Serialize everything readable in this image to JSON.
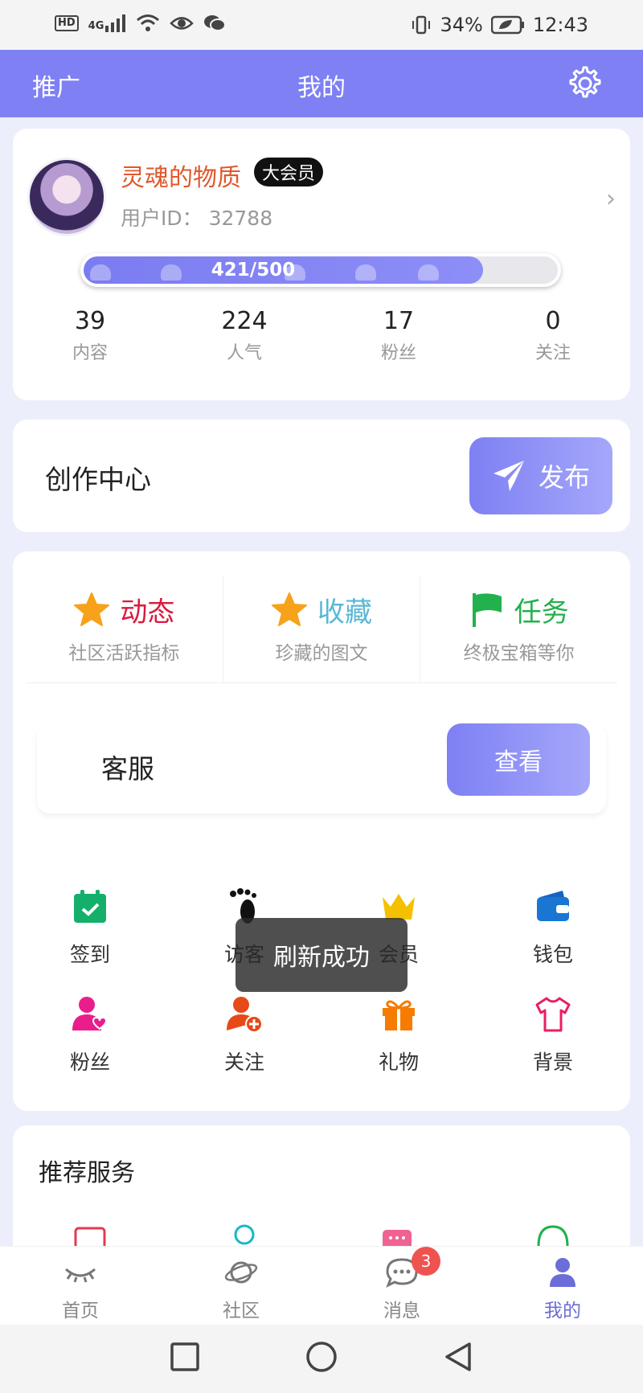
{
  "status_bar": {
    "hd": "HD",
    "network": "4G",
    "battery": "34%",
    "time": "12:43"
  },
  "header": {
    "left_label": "推广",
    "title": "我的"
  },
  "profile": {
    "nickname": "灵魂的物质",
    "vip_label": "大会员",
    "user_id_label": "用户ID",
    "user_id": "32788",
    "exp_text": "421/500",
    "exp_fraction": 0.842,
    "stats": [
      {
        "value": "39",
        "label": "内容"
      },
      {
        "value": "224",
        "label": "人气"
      },
      {
        "value": "17",
        "label": "粉丝"
      },
      {
        "value": "0",
        "label": "关注"
      }
    ]
  },
  "creation": {
    "title": "创作中心",
    "publish_label": "发布"
  },
  "features": [
    {
      "name": "动态",
      "desc": "社区活跃指标",
      "color": "#d81b3f",
      "icon": "star-icon"
    },
    {
      "name": "收藏",
      "desc": "珍藏的图文",
      "color": "#5ab7d6",
      "icon": "star-icon"
    },
    {
      "name": "任务",
      "desc": "终极宝箱等你",
      "color": "#22b14c",
      "icon": "flag-icon"
    }
  ],
  "service": {
    "label": "客服",
    "view_label": "查看"
  },
  "grid": [
    {
      "label": "签到",
      "icon": "calendar-check-icon",
      "color": "#14b06b"
    },
    {
      "label": "访客",
      "icon": "footprint-icon",
      "color": "#111111"
    },
    {
      "label": "会员",
      "icon": "crown-icon",
      "color": "#f5c000"
    },
    {
      "label": "钱包",
      "icon": "wallet-icon",
      "color": "#1976d2"
    },
    {
      "label": "粉丝",
      "icon": "user-heart-icon",
      "color": "#e91e8c"
    },
    {
      "label": "关注",
      "icon": "user-add-icon",
      "color": "#e64a19"
    },
    {
      "label": "礼物",
      "icon": "gift-icon",
      "color": "#f57c00"
    },
    {
      "label": "背景",
      "icon": "tshirt-icon",
      "color": "#e91e63"
    }
  ],
  "recommend": {
    "title": "推荐服务"
  },
  "toast": "刷新成功",
  "bottom_nav": [
    {
      "label": "首页",
      "icon": "eye-closed-icon"
    },
    {
      "label": "社区",
      "icon": "planet-icon"
    },
    {
      "label": "消息",
      "icon": "chat-icon",
      "badge": "3"
    },
    {
      "label": "我的",
      "icon": "user-icon",
      "active": true
    }
  ]
}
